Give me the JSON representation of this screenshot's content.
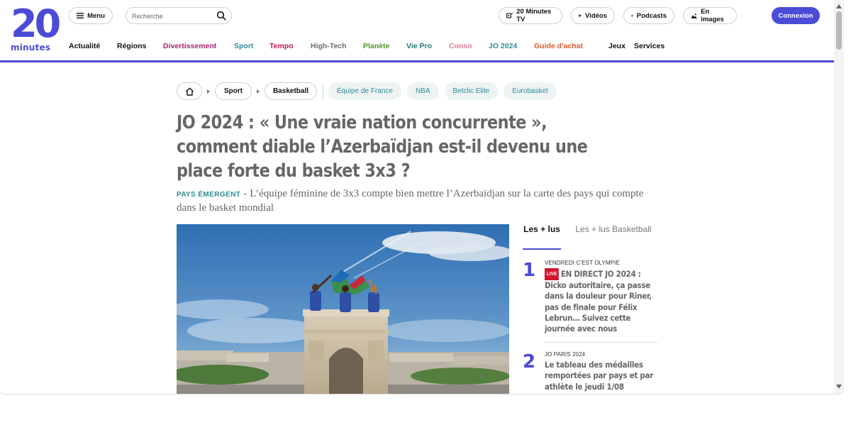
{
  "header": {
    "logo_digits": "20",
    "logo_word": "minutes",
    "menu_label": "Menu",
    "search_placeholder": "Recherche",
    "tv_label": "20 Minutes TV",
    "videos_label": "Vidéos",
    "podcasts_label": "Podcasts",
    "images_label": "En images",
    "login_label": "Connexion",
    "accent_color": "#4a4bd6"
  },
  "nav": [
    {
      "label": "Actualité",
      "color": "#111111"
    },
    {
      "label": "Régions",
      "color": "#111111"
    },
    {
      "label": "Divertissement",
      "color": "#a6266e"
    },
    {
      "label": "Sport",
      "color": "#2f8b96"
    },
    {
      "label": "Tempo",
      "color": "#c2185b"
    },
    {
      "label": "High-Tech",
      "color": "#6b6b6b"
    },
    {
      "label": "Planète",
      "color": "#4e9a2f"
    },
    {
      "label": "Vie Pro",
      "color": "#1f7a6e"
    },
    {
      "label": "Conso",
      "color": "#e07a8f"
    },
    {
      "label": "JO 2024",
      "color": "#2f8b96"
    },
    {
      "label": "Guide d'achat",
      "color": "#e05a2b"
    },
    {
      "label": "Jeux",
      "color": "#111111"
    },
    {
      "label": "Services",
      "color": "#111111"
    }
  ],
  "breadcrumb": {
    "items": [
      "Sport",
      "Basketball"
    ],
    "tags": [
      "Équipe de France",
      "NBA",
      "Betclic Elite",
      "Eurobasket"
    ]
  },
  "article": {
    "title": "JO 2024 : « Une vraie nation concurrente », comment diable l’Azerbaïdjan est-il devenu une place forte du basket 3x3 ?",
    "kicker": "PAYS ÉMERGENT",
    "lead": "L’équipe féminine de 3x3 compte bien mettre l’Azerbaïdjan sur la carte des pays qui compte dans le basket mondial"
  },
  "sidebar": {
    "tabs": [
      "Les + lus",
      "Les + lus Basketball"
    ],
    "items": [
      {
        "rank": "1",
        "kicker": "VENDREDI C’EST OLYMPIE",
        "live": "LIVE",
        "title": "EN DIRECT JO 2024 : Dicko autoritaire, ça passe dans la douleur pour Riner, pas de finale pour Félix Lebrun… Suivez cette journée avec nous"
      },
      {
        "rank": "2",
        "kicker": "JO PARIS 2024",
        "title": "Le tableau des médailles remportées par pays et par athlète le jeudi 1/08"
      }
    ]
  }
}
